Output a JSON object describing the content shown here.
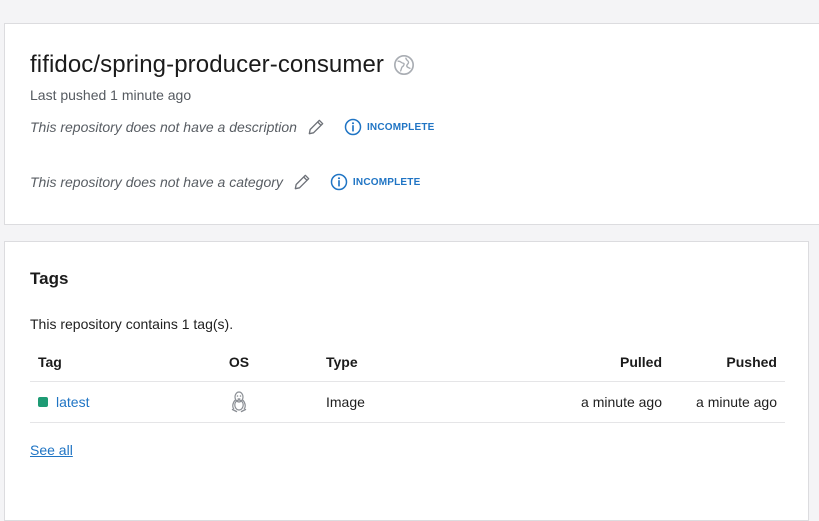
{
  "repo": {
    "title": "fifidoc/spring-producer-consumer",
    "last_pushed": "Last pushed 1 minute ago",
    "description_text": "This repository does not have a description",
    "description_status": "INCOMPLETE",
    "category_text": "This repository does not have a category",
    "category_status": "INCOMPLETE"
  },
  "tags": {
    "heading": "Tags",
    "count_text": "This repository contains 1 tag(s).",
    "columns": {
      "tag": "Tag",
      "os": "OS",
      "type": "Type",
      "pulled": "Pulled",
      "pushed": "Pushed"
    },
    "rows": [
      {
        "tag": "latest",
        "os_icon": "linux-icon",
        "type": "Image",
        "pulled": "a minute ago",
        "pushed": "a minute ago"
      }
    ],
    "see_all": "See all"
  },
  "colors": {
    "link": "#1f74c4",
    "status_incomplete": "#1f74c4",
    "tag_dot": "#1e9b74"
  }
}
